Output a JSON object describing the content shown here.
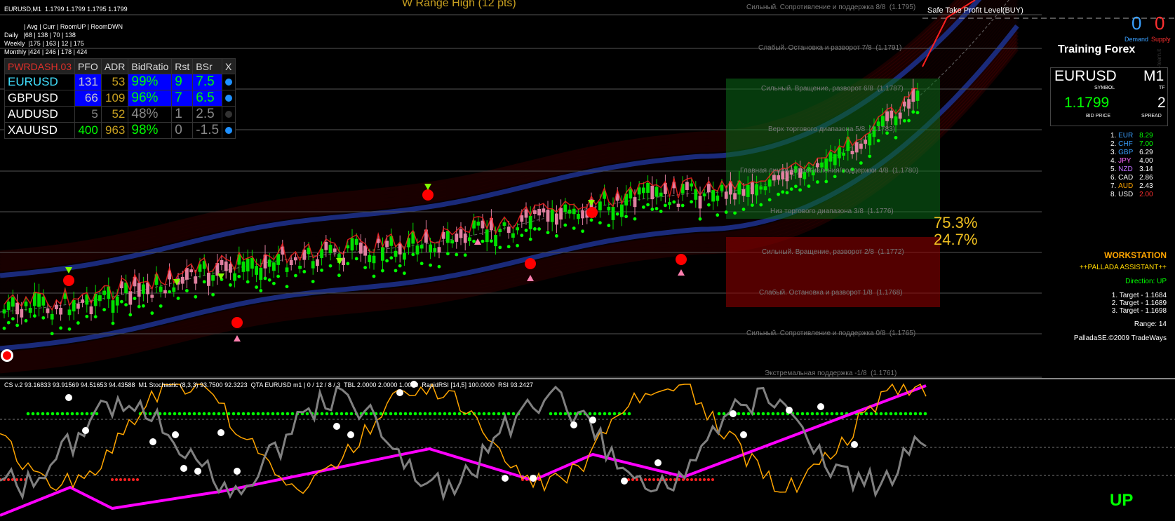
{
  "window": {
    "symbol_header": "EURUSD,M1  1.1799 1.1799 1.1795 1.1799",
    "range_title": "W Range High (12 pts)",
    "safe_take_profit": "Safe Take Profit Level(BUY)",
    "watermark": "www.trading-team.it"
  },
  "avg_panel": {
    "header": "| Avg | Curr | RoomUP | RoomDWN",
    "rows": [
      "Daily   |68 | 138 | 70 | 138",
      "Weekly  |175 | 163 | 12 | 175",
      "Monthly |424 | 246 | 178 | 424"
    ]
  },
  "dashboard": {
    "columns": [
      "PWRDASH.03",
      "PFO",
      "ADR",
      "BidRatio",
      "Rst",
      "BSr",
      "X"
    ],
    "rows": [
      {
        "symbol": "EURUSD",
        "pfo": "131",
        "adr": "53",
        "bidratio": "99%",
        "rst": "9",
        "bsr": "7.5",
        "status_color": "#1e90ff"
      },
      {
        "symbol": "GBPUSD",
        "pfo": "66",
        "adr": "109",
        "bidratio": "96%",
        "rst": "7",
        "bsr": "6.5",
        "status_color": "#1e90ff"
      },
      {
        "symbol": "AUDUSD",
        "pfo": "5",
        "adr": "52",
        "bidratio": "48%",
        "rst": "1",
        "bsr": "2.5",
        "status_color": "#333333"
      },
      {
        "symbol": "XAUUSD",
        "pfo": "400",
        "adr": "963",
        "bidratio": "98%",
        "rst": "0",
        "bsr": "-1.5",
        "status_color": "#1e90ff"
      }
    ]
  },
  "murrey_levels": [
    "Сильный. Сопротивление и поддержка 8/8  (1.1795)",
    "Слабый. Остановка и разворот 7/8  (1.1791)",
    "Сильный. Вращение, разворот 6/8  (1.1787)",
    "Верх торгового диапазона 5/8  (1.1783)",
    "Главная линия сопротивления/поддержки 4/8  (1.1780)",
    "Низ торгового диапазона 3/8  (1.1776)",
    "Сильный. Вращение, разворот 2/8  (1.1772)",
    "Слабый. Остановка и разворот 1/8  (1.1768)",
    "Сильный. Сопротивление и поддержка 0/8  (1.1765)",
    "Экстремальная поддержка -1/8  (1.1761)"
  ],
  "percent": {
    "up": "75.3%",
    "down": "24.7%"
  },
  "demand_supply": {
    "demand_value": "0",
    "supply_value": "0",
    "demand_label": "Demand",
    "supply_label": "Supply"
  },
  "symbol_panel": {
    "brand": "Training Forex",
    "symbol": "EURUSD",
    "symbol_label": "SYMBOL",
    "tf": "M1",
    "tf_label": "TF",
    "bid": "1.1799",
    "bid_label": "BID PRICE",
    "spread": "2",
    "spread_label": "SPREAD"
  },
  "currency_strength": [
    {
      "rank": "1.",
      "code": "EUR",
      "value": "8.29",
      "color": "#3aa0ff",
      "vcolor": "#00ff00"
    },
    {
      "rank": "2.",
      "code": "CHF",
      "value": "7.00",
      "color": "#3aa0ff",
      "vcolor": "#00ff00"
    },
    {
      "rank": "3.",
      "code": "GBP",
      "value": "6.29",
      "color": "#3aa0ff",
      "vcolor": "#ffffff"
    },
    {
      "rank": "4.",
      "code": "JPY",
      "value": "4.00",
      "color": "#ff6aff",
      "vcolor": "#ffffff"
    },
    {
      "rank": "5.",
      "code": "NZD",
      "value": "3.14",
      "color": "#c070ff",
      "vcolor": "#ffffff"
    },
    {
      "rank": "6.",
      "code": "CAD",
      "value": "2.86",
      "color": "#ffffff",
      "vcolor": "#ffffff"
    },
    {
      "rank": "7.",
      "code": "AUD",
      "value": "2.43",
      "color": "#ffa500",
      "vcolor": "#ffffff"
    },
    {
      "rank": "8.",
      "code": "USD",
      "value": "2.00",
      "color": "#ffffff",
      "vcolor": "#ff3030"
    }
  ],
  "workstation": {
    "title": "WORKSTATION",
    "subtitle": "++PALLADA ASSISTANT++",
    "direction": "Direction: UP",
    "targets": [
      "1. Target - 1.1684",
      "2. Target - 1.1689",
      "3. Target - 1.1698"
    ],
    "range": "Range: 14",
    "footer": "PalladaSE.©2009 TradeWays"
  },
  "sub_window": {
    "indicators": "CS v.2 93.16833 93.91569 94.51653 94.43588  M1 Stochastic (8,3,3) 93.7500 92.3223  QTA EURUSD m1 | 0 / 12 / 8 / 3  TBL 2.0000 2.0000 1.0000  RapidRSI [14,5] 100.0000  RSI 93.2427",
    "signal": "UP"
  },
  "colors": {
    "candle_up": "#00e000",
    "candle_down": "#e080a0",
    "band_blue": "#1a2a7a",
    "band_red": "#8b0000",
    "stoch": "#ffa500",
    "rsi": "#808080",
    "trend": "#ff00ff",
    "green_dots": "#00ff00"
  }
}
